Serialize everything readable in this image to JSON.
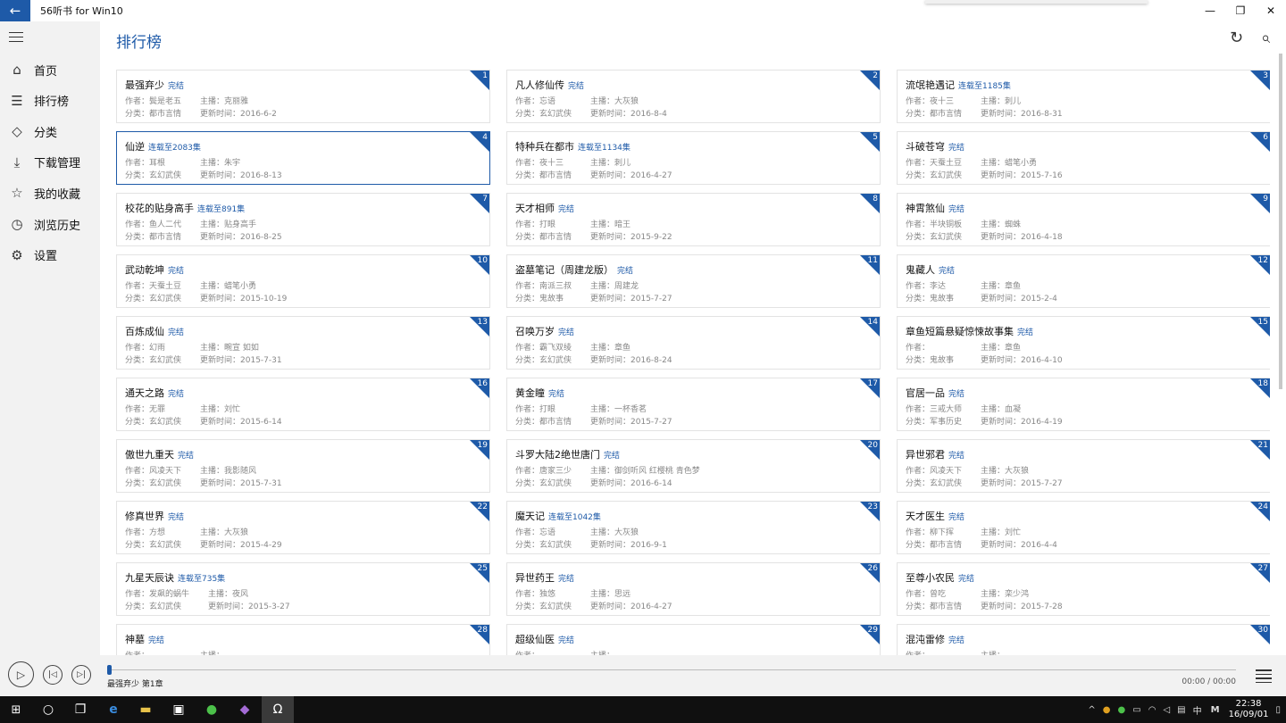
{
  "window": {
    "title": "56听书 for Win10",
    "minimize": "—",
    "maximize": "❐",
    "close": "✕"
  },
  "nav": [
    {
      "label": "首页",
      "icon": "home-icon",
      "glyph": "⌂"
    },
    {
      "label": "排行榜",
      "icon": "list-icon",
      "glyph": "☰"
    },
    {
      "label": "分类",
      "icon": "tag-icon",
      "glyph": "◇"
    },
    {
      "label": "下载管理",
      "icon": "download-icon",
      "glyph": "⤓"
    },
    {
      "label": "我的收藏",
      "icon": "star-icon",
      "glyph": "☆"
    },
    {
      "label": "浏览历史",
      "icon": "clock-icon",
      "glyph": "◷"
    },
    {
      "label": "设置",
      "icon": "gear-icon",
      "glyph": "⚙"
    }
  ],
  "page": {
    "title": "排行榜",
    "refresh_icon": "↻",
    "search_icon": "⌕"
  },
  "labels": {
    "author": "作者：",
    "narrator": "主播：",
    "category": "分类：",
    "updated": "更新时间："
  },
  "cards": [
    {
      "rank": "1",
      "title": "最强弃少",
      "status": "完结",
      "author": "鬓是老五",
      "narrator": "克丽雅",
      "category": "都市言情",
      "updated": "2016-6-2"
    },
    {
      "rank": "2",
      "title": "凡人修仙传",
      "status": "完结",
      "author": "忘语",
      "narrator": "大灰狼",
      "category": "玄幻武侠",
      "updated": "2016-8-4"
    },
    {
      "rank": "3",
      "title": "流氓艳遇记",
      "status": "连载至1185集",
      "author": "夜十三",
      "narrator": "刺儿",
      "category": "都市言情",
      "updated": "2016-8-31"
    },
    {
      "rank": "4",
      "title": "仙逆",
      "status": "连载至2083集",
      "author": "耳根",
      "narrator": "朱宇",
      "category": "玄幻武侠",
      "updated": "2016-8-13"
    },
    {
      "rank": "5",
      "title": "特种兵在都市",
      "status": "连载至1134集",
      "author": "夜十三",
      "narrator": "刺儿",
      "category": "都市言情",
      "updated": "2016-4-27"
    },
    {
      "rank": "6",
      "title": "斗破苍穹",
      "status": "完结",
      "author": "天蚕土豆",
      "narrator": "蜡笔小勇",
      "category": "玄幻武侠",
      "updated": "2015-7-16"
    },
    {
      "rank": "7",
      "title": "校花的贴身高手",
      "status": "连载至891集",
      "author": "鱼人二代",
      "narrator": "贴身高手",
      "category": "都市言情",
      "updated": "2016-8-25"
    },
    {
      "rank": "8",
      "title": "天才相师",
      "status": "完结",
      "author": "打眼",
      "narrator": "暗王",
      "category": "都市言情",
      "updated": "2015-9-22"
    },
    {
      "rank": "9",
      "title": "神霄煞仙",
      "status": "完结",
      "author": "半块铜板",
      "narrator": "蜘蛛",
      "category": "玄幻武侠",
      "updated": "2016-4-18"
    },
    {
      "rank": "10",
      "title": "武动乾坤",
      "status": "完结",
      "author": "天蚕土豆",
      "narrator": "蜡笔小勇",
      "category": "玄幻武侠",
      "updated": "2015-10-19"
    },
    {
      "rank": "11",
      "title": "盗墓笔记（周建龙版）",
      "status": "完结",
      "author": "南派三叔",
      "narrator": "周建龙",
      "category": "鬼故事",
      "updated": "2015-7-27"
    },
    {
      "rank": "12",
      "title": "鬼藏人",
      "status": "完结",
      "author": "李达",
      "narrator": "章鱼",
      "category": "鬼故事",
      "updated": "2015-2-4"
    },
    {
      "rank": "13",
      "title": "百炼成仙",
      "status": "完结",
      "author": "幻雨",
      "narrator": "畹宣 如如",
      "category": "玄幻武侠",
      "updated": "2015-7-31"
    },
    {
      "rank": "14",
      "title": "召唤万岁",
      "status": "完结",
      "author": "霸飞双绫",
      "narrator": "章鱼",
      "category": "玄幻武侠",
      "updated": "2016-8-24"
    },
    {
      "rank": "15",
      "title": "章鱼短篇悬疑惊悚故事集",
      "status": "完结",
      "author": "",
      "narrator": "章鱼",
      "category": "鬼故事",
      "updated": "2016-4-10"
    },
    {
      "rank": "16",
      "title": "通天之路",
      "status": "完结",
      "author": "无罪",
      "narrator": "刘忙",
      "category": "玄幻武侠",
      "updated": "2015-6-14"
    },
    {
      "rank": "17",
      "title": "黄金瞳",
      "status": "完结",
      "author": "打眼",
      "narrator": "一杯香茗",
      "category": "都市言情",
      "updated": "2015-7-27"
    },
    {
      "rank": "18",
      "title": "官居一品",
      "status": "完结",
      "author": "三戒大师",
      "narrator": "血凝",
      "category": "军事历史",
      "updated": "2016-4-19"
    },
    {
      "rank": "19",
      "title": "傲世九重天",
      "status": "完结",
      "author": "风凌天下",
      "narrator": "我影随风",
      "category": "玄幻武侠",
      "updated": "2015-7-31"
    },
    {
      "rank": "20",
      "title": "斗罗大陆2绝世唐门",
      "status": "完结",
      "author": "唐家三少",
      "narrator": "御剑听风 红樱桃 青色梦",
      "category": "玄幻武侠",
      "updated": "2016-6-14"
    },
    {
      "rank": "21",
      "title": "异世邪君",
      "status": "完结",
      "author": "风凌天下",
      "narrator": "大灰狼",
      "category": "玄幻武侠",
      "updated": "2015-7-27"
    },
    {
      "rank": "22",
      "title": "修真世界",
      "status": "完结",
      "author": "方想",
      "narrator": "大灰狼",
      "category": "玄幻武侠",
      "updated": "2015-4-29"
    },
    {
      "rank": "23",
      "title": "魔天记",
      "status": "连载至1042集",
      "author": "忘语",
      "narrator": "大灰狼",
      "category": "玄幻武侠",
      "updated": "2016-9-1"
    },
    {
      "rank": "24",
      "title": "天才医生",
      "status": "完结",
      "author": "柳下挥",
      "narrator": "刘忙",
      "category": "都市言情",
      "updated": "2016-4-4"
    },
    {
      "rank": "25",
      "title": "九星天辰诀",
      "status": "连载至735集",
      "author": "发飙的蜗牛",
      "narrator": "夜风",
      "category": "玄幻武侠",
      "updated": "2015-3-27"
    },
    {
      "rank": "26",
      "title": "异世药王",
      "status": "完结",
      "author": "独悠",
      "narrator": "思远",
      "category": "玄幻武侠",
      "updated": "2016-4-27"
    },
    {
      "rank": "27",
      "title": "至尊小农民",
      "status": "完结",
      "author": "曾吃",
      "narrator": "栾少鸿",
      "category": "都市言情",
      "updated": "2015-7-28"
    },
    {
      "rank": "28",
      "title": "神墓",
      "status": "完结",
      "author": "",
      "narrator": "",
      "category": "",
      "updated": ""
    },
    {
      "rank": "29",
      "title": "超级仙医",
      "status": "完结",
      "author": "",
      "narrator": "",
      "category": "",
      "updated": ""
    },
    {
      "rank": "30",
      "title": "混沌雷修",
      "status": "完结",
      "author": "",
      "narrator": "",
      "category": "",
      "updated": ""
    }
  ],
  "selected_rank": "4",
  "player": {
    "now_playing": "最强弃少 第1章",
    "time": "00:00 / 00:00",
    "progress": 0
  },
  "taskbar": {
    "time": "22:38",
    "date": "16/09/01",
    "lang": "中",
    "ime": "M"
  },
  "colors": {
    "accent": "#1e5aa8"
  }
}
